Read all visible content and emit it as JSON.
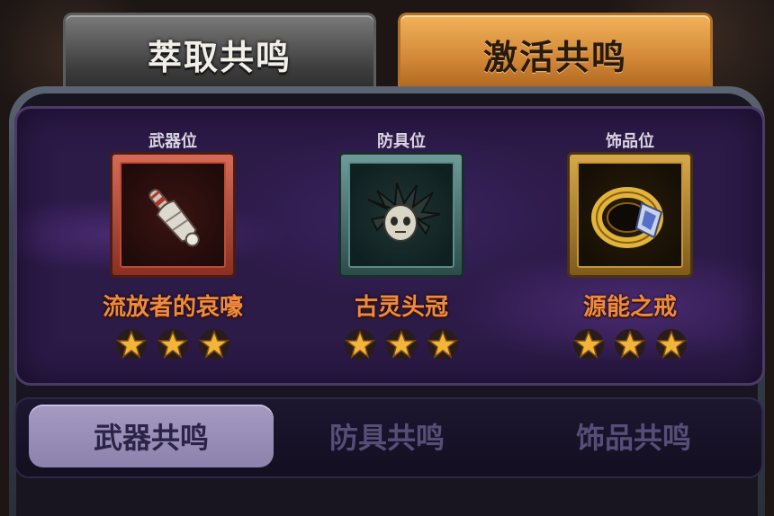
{
  "top_tabs": {
    "extract": "萃取共鸣",
    "activate": "激活共鸣"
  },
  "slots": [
    {
      "label": "武器位",
      "item_name": "流放者的哀嚎",
      "stars": 3,
      "frame_color": "#c44a36",
      "icon": "bone-club-icon"
    },
    {
      "label": "防具位",
      "item_name": "古灵头冠",
      "stars": 3,
      "frame_color": "#5c8a87",
      "icon": "feathered-crown-icon"
    },
    {
      "label": "饰品位",
      "item_name": "源能之戒",
      "stars": 3,
      "frame_color": "#c8962f",
      "icon": "gold-ring-icon"
    }
  ],
  "sub_tabs": [
    "武器共鸣",
    "防具共鸣",
    "饰品共鸣"
  ],
  "active_sub_tab": "武器共鸣",
  "colors": {
    "accent_orange": "#d08534",
    "item_name": "#f08a3c",
    "panel_purple": "#2c1a47",
    "star_gold": "#f2b53a"
  }
}
